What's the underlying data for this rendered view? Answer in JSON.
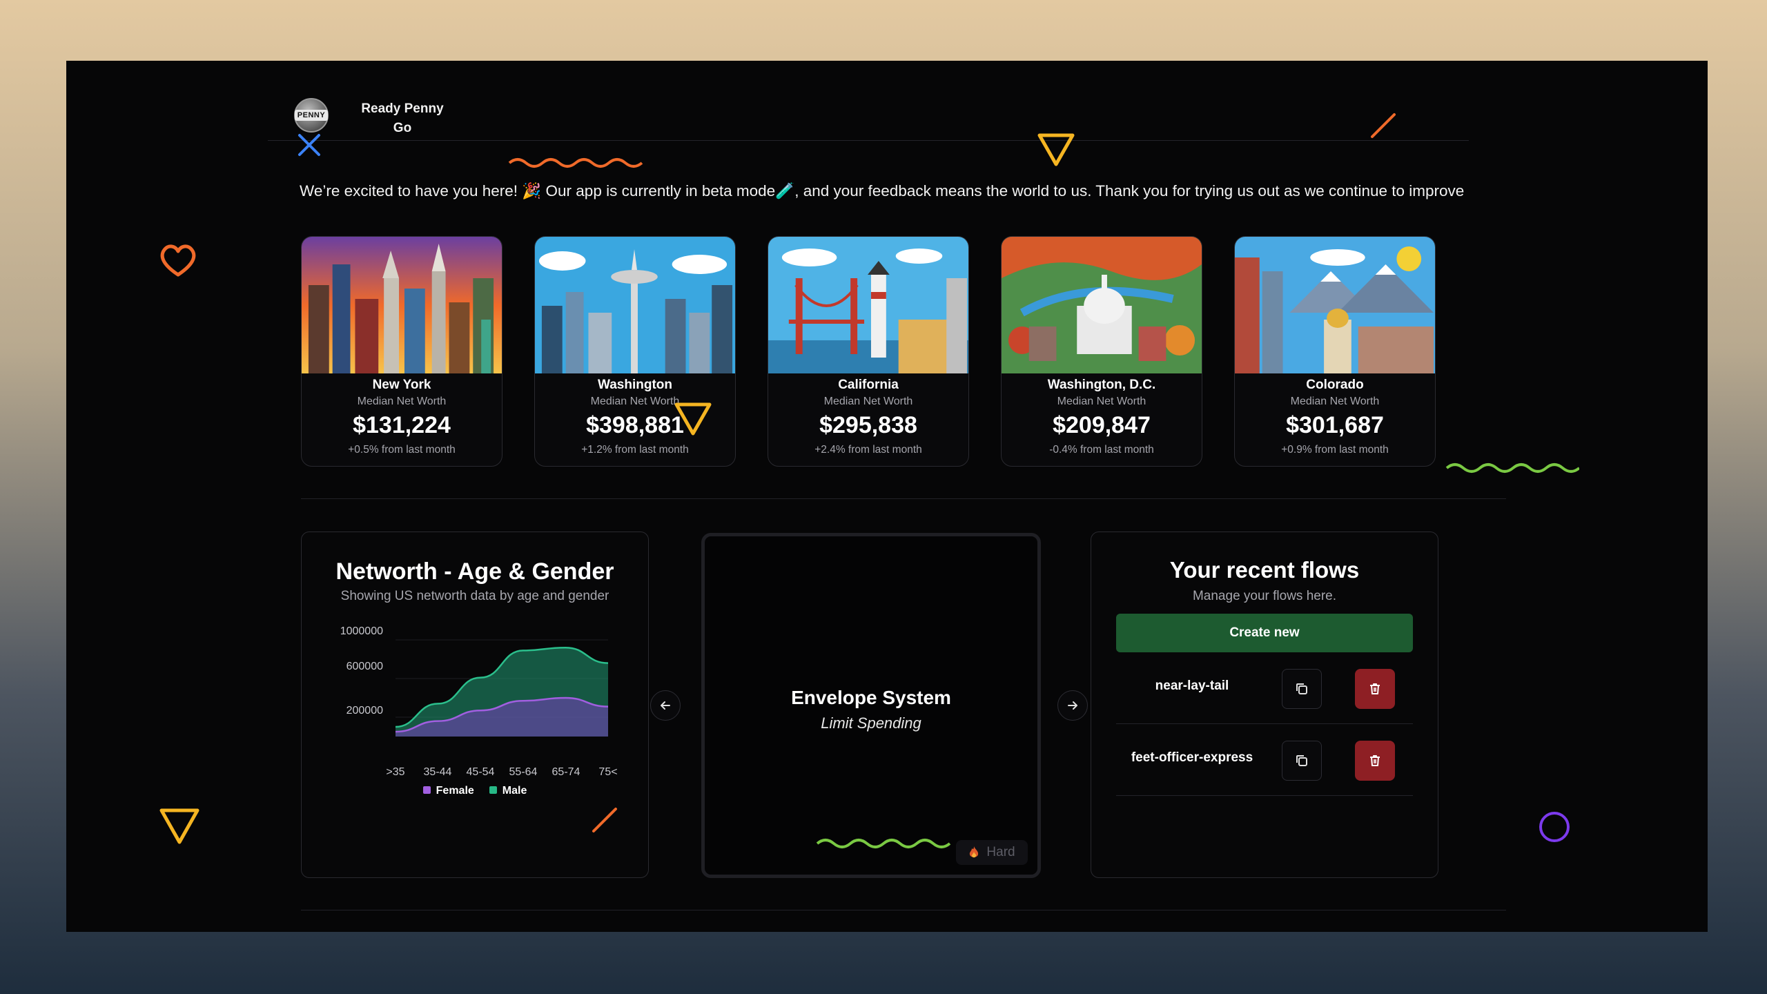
{
  "brand": {
    "line1": "Ready Penny",
    "line2": "Go",
    "logo_text": "PENNY"
  },
  "welcome_message": "We’re excited to have you here! 🎉 Our app is currently in beta mode🧪, and your feedback means the world to us. Thank you for trying us out as we continue to improve",
  "cities": [
    {
      "name": "New York",
      "label": "Median Net Worth",
      "value": "$131,224",
      "change": "+0.5% from last month"
    },
    {
      "name": "Washington",
      "label": "Median Net Worth",
      "value": "$398,881",
      "change": "+1.2% from last month"
    },
    {
      "name": "California",
      "label": "Median Net Worth",
      "value": "$295,838",
      "change": "+2.4% from last month"
    },
    {
      "name": "Washington, D.C.",
      "label": "Median Net Worth",
      "value": "$209,847",
      "change": "-0.4% from last month"
    },
    {
      "name": "Colorado",
      "label": "Median Net Worth",
      "value": "$301,687",
      "change": "+0.9% from last month"
    }
  ],
  "chart_panel": {
    "title": "Networth - Age & Gender",
    "subtitle": "Showing US networth data by age and gender"
  },
  "chart_data": {
    "type": "area",
    "title": "Networth - Age & Gender",
    "subtitle": "Showing US networth data by age and gender",
    "categories": [
      ">35",
      "35-44",
      "45-54",
      "55-64",
      "65-74",
      "75<"
    ],
    "y_ticks": [
      "1000000",
      "600000",
      "200000"
    ],
    "ylim": [
      0,
      1100000
    ],
    "legend_position": "bottom",
    "stacked": true,
    "series": [
      {
        "name": "Female",
        "color": "#8a4fc9",
        "values": [
          50000,
          160000,
          270000,
          370000,
          400000,
          310000
        ]
      },
      {
        "name": "Male",
        "color": "#27a17a",
        "values": [
          50000,
          180000,
          340000,
          520000,
          520000,
          450000
        ]
      }
    ]
  },
  "flow_card": {
    "title": "Envelope System",
    "subtitle": "Limit Spending",
    "difficulty": "Hard"
  },
  "recent_flows": {
    "title": "Your recent flows",
    "subtitle": "Manage your flows here.",
    "create_label": "Create new",
    "items": [
      {
        "name": "near-lay-tail"
      },
      {
        "name": "feet-officer-express"
      }
    ]
  },
  "colors": {
    "accent_green": "#1d5b30",
    "danger": "#8e1f24",
    "background": "#060607"
  }
}
